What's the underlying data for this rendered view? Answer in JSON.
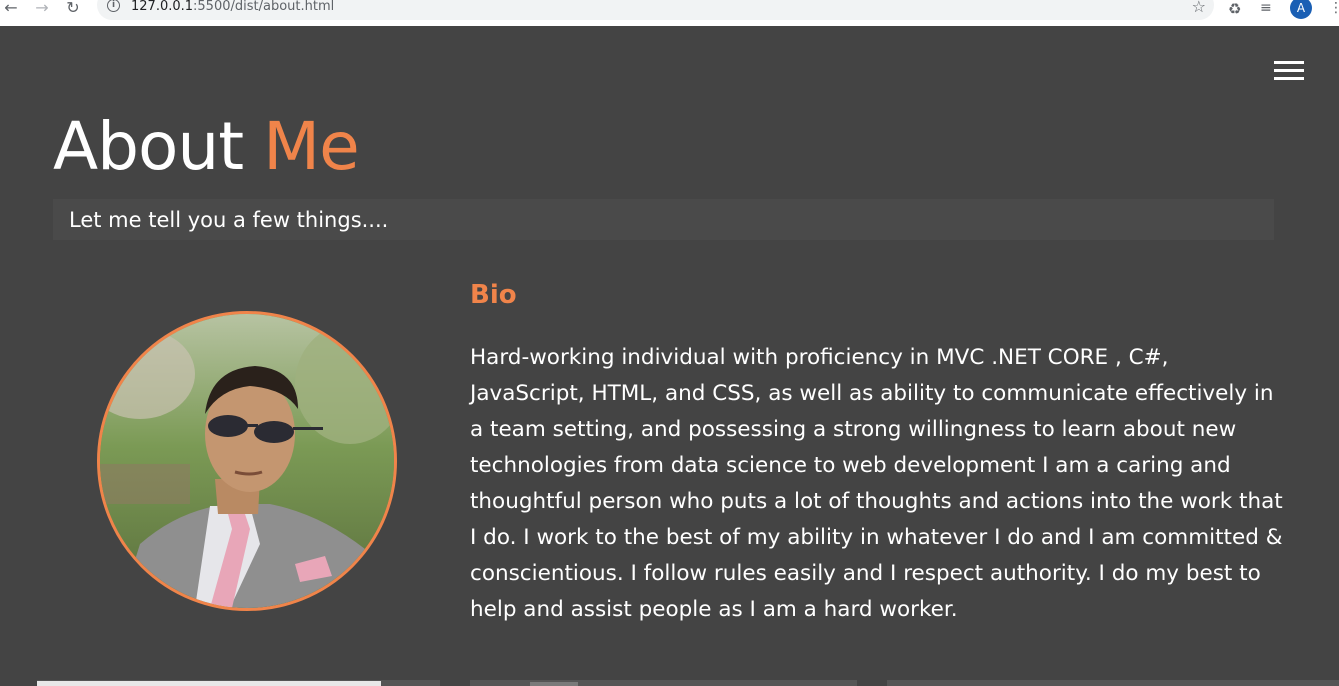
{
  "browser": {
    "url_host": "127.0.0.1",
    "url_rest": ":5500/dist/about.html",
    "avatar_letter": "A",
    "icons": [
      "back-arrow-icon",
      "forward-arrow-icon",
      "reload-icon",
      "info-icon",
      "star-icon",
      "extensions-icon",
      "media-control-icon",
      "more-menu-icon"
    ]
  },
  "nav": {
    "menu_icon": "hamburger-menu-icon"
  },
  "header": {
    "title_main": "About",
    "title_accent": "Me",
    "tagline": "Let me tell you a few things...."
  },
  "bio": {
    "title": "Bio",
    "text": "Hard-working individual with proficiency in MVC .NET CORE , C#, JavaScript, HTML, and CSS, as well as ability to communicate effectively in a team setting, and possessing a strong willingness to learn about new technologies from data science to web development I am a caring and thoughtful person who puts a lot of thoughts and actions into the work that I do. I work to the best of my ability in whatever I do and I am committed & conscientious. I follow rules easily and I respect authority. I do my best to help and assist people as I am a hard worker."
  },
  "colors": {
    "background": "#444444",
    "accent": "#f0844a",
    "text": "#ffffff"
  }
}
